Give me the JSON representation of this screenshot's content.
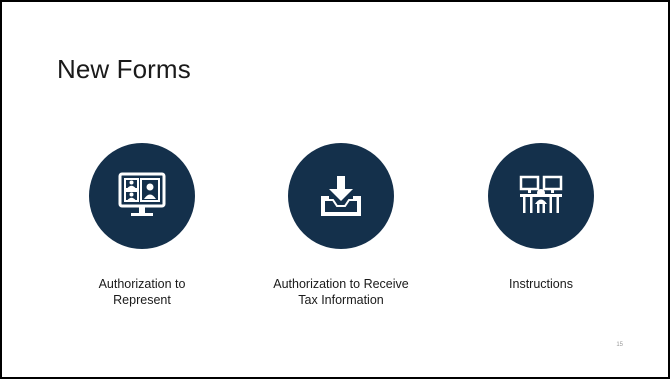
{
  "slide": {
    "title": "New Forms",
    "page_number": "15",
    "accent_color": "#14304b",
    "items": [
      {
        "label": "Authorization to Represent",
        "icon": "video-conference-icon"
      },
      {
        "label": "Authorization to Receive Tax Information",
        "icon": "inbox-download-icon"
      },
      {
        "label": "Instructions",
        "icon": "meeting-table-icon"
      }
    ]
  }
}
